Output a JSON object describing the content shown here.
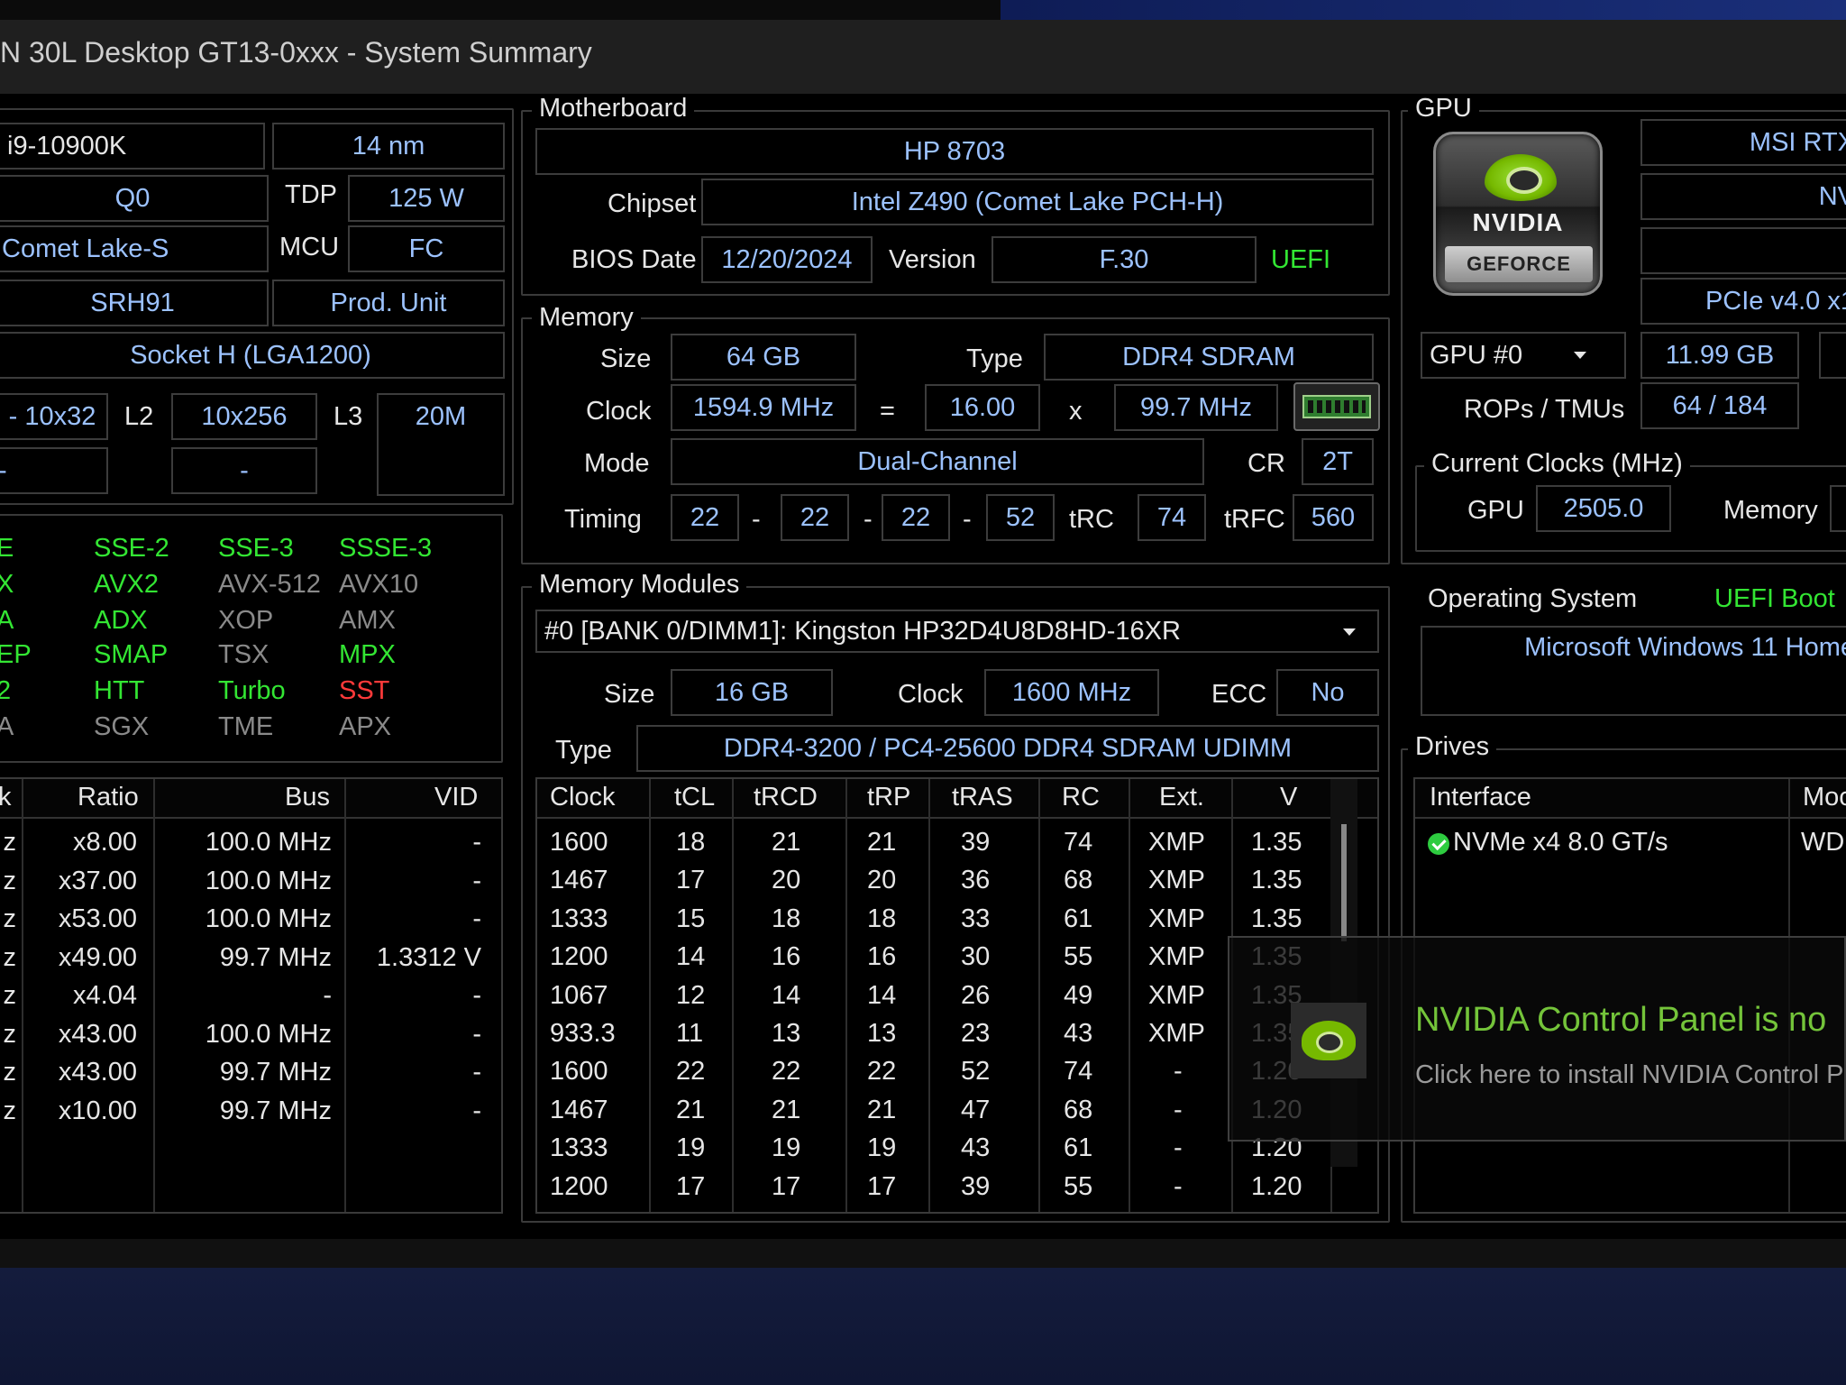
{
  "window": {
    "title": "N 30L Desktop GT13-0xxx - System Summary"
  },
  "cpu": {
    "name": "i9-10900K",
    "process": "14 nm",
    "stepping": "Q0",
    "tdp_label": "TDP",
    "tdp": "125 W",
    "codename": "Comet Lake-S",
    "mcu_label": "MCU",
    "mcu": "FC",
    "sspec": "SRH91",
    "prod_unit": "Prod. Unit",
    "socket": "Socket H (LGA1200)",
    "l1": "- 10x32",
    "l2_label": "L2",
    "l2": "10x256",
    "l3_label": "L3",
    "l3": "20M",
    "l1b": "-",
    "l2b": "-",
    "features": [
      {
        "text": "E",
        "color": "green"
      },
      {
        "text": "SSE-2",
        "color": "green"
      },
      {
        "text": "SSE-3",
        "color": "green"
      },
      {
        "text": "SSSE-3",
        "color": "green"
      },
      {
        "text": "X",
        "color": "green"
      },
      {
        "text": "AVX2",
        "color": "green"
      },
      {
        "text": "AVX-512",
        "color": "gray"
      },
      {
        "text": "AVX10",
        "color": "gray"
      },
      {
        "text": "A",
        "color": "green"
      },
      {
        "text": "ADX",
        "color": "green"
      },
      {
        "text": "XOP",
        "color": "gray"
      },
      {
        "text": "AMX",
        "color": "gray"
      },
      {
        "text": "EP",
        "color": "green"
      },
      {
        "text": "SMAP",
        "color": "green"
      },
      {
        "text": "TSX",
        "color": "gray"
      },
      {
        "text": "MPX",
        "color": "green"
      },
      {
        "text": "2",
        "color": "green"
      },
      {
        "text": "HTT",
        "color": "green"
      },
      {
        "text": "Turbo",
        "color": "green"
      },
      {
        "text": "SST",
        "color": "red"
      },
      {
        "text": "A",
        "color": "gray"
      },
      {
        "text": "SGX",
        "color": "gray"
      },
      {
        "text": "TME",
        "color": "gray"
      },
      {
        "text": "APX",
        "color": "gray"
      }
    ],
    "clock_table": {
      "headers": [
        "k",
        "Ratio",
        "Bus",
        "VID"
      ],
      "rows": [
        [
          "z",
          "x8.00",
          "100.0 MHz",
          "-"
        ],
        [
          "z",
          "x37.00",
          "100.0 MHz",
          "-"
        ],
        [
          "z",
          "x53.00",
          "100.0 MHz",
          "-"
        ],
        [
          "z",
          "x49.00",
          "99.7 MHz",
          "1.3312 V"
        ],
        [
          "z",
          "x4.04",
          "-",
          "-"
        ],
        [
          "z",
          "x43.00",
          "100.0 MHz",
          "-"
        ],
        [
          "z",
          "x43.00",
          "99.7 MHz",
          "-"
        ],
        [
          "z",
          "x10.00",
          "99.7 MHz",
          "-"
        ]
      ]
    }
  },
  "motherboard": {
    "label": "Motherboard",
    "model": "HP 8703",
    "chipset_label": "Chipset",
    "chipset": "Intel Z490 (Comet Lake PCH-H)",
    "bios_date_label": "BIOS Date",
    "bios_date": "12/20/2024",
    "version_label": "Version",
    "version": "F.30",
    "uefi": "UEFI"
  },
  "memory": {
    "label": "Memory",
    "size_label": "Size",
    "size": "64 GB",
    "type_label": "Type",
    "type": "DDR4 SDRAM",
    "clock_label": "Clock",
    "clock": "1594.9 MHz",
    "eq": "=",
    "multiplier": "16.00",
    "x": "x",
    "bus": "99.7 MHz",
    "mode_label": "Mode",
    "mode": "Dual-Channel",
    "cr_label": "CR",
    "cr": "2T",
    "timing_label": "Timing",
    "t1": "22",
    "t2": "22",
    "t3": "22",
    "t4": "52",
    "dash": "-",
    "trc_label": "tRC",
    "trc": "74",
    "trfc_label": "tRFC",
    "trfc": "560"
  },
  "modules": {
    "label": "Memory Modules",
    "selected": "#0 [BANK 0/DIMM1]: Kingston HP32D4U8D8HD-16XR",
    "size_label": "Size",
    "size": "16 GB",
    "clock_label": "Clock",
    "clock": "1600 MHz",
    "ecc_label": "ECC",
    "ecc": "No",
    "type_label": "Type",
    "type": "DDR4-3200 / PC4-25600 DDR4 SDRAM UDIMM",
    "table": {
      "headers": [
        "Clock",
        "tCL",
        "tRCD",
        "tRP",
        "tRAS",
        "RC",
        "Ext.",
        "V"
      ],
      "rows": [
        [
          "1600",
          "18",
          "21",
          "21",
          "39",
          "74",
          "XMP",
          "1.35"
        ],
        [
          "1467",
          "17",
          "20",
          "20",
          "36",
          "68",
          "XMP",
          "1.35"
        ],
        [
          "1333",
          "15",
          "18",
          "18",
          "33",
          "61",
          "XMP",
          "1.35"
        ],
        [
          "1200",
          "14",
          "16",
          "16",
          "30",
          "55",
          "XMP",
          "1.35"
        ],
        [
          "1067",
          "12",
          "14",
          "14",
          "26",
          "49",
          "XMP",
          "1.35"
        ],
        [
          "933.3",
          "11",
          "13",
          "13",
          "23",
          "43",
          "XMP",
          "1.35"
        ],
        [
          "1600",
          "22",
          "22",
          "22",
          "52",
          "74",
          "-",
          "1.20"
        ],
        [
          "1467",
          "21",
          "21",
          "21",
          "47",
          "68",
          "-",
          "1.20"
        ],
        [
          "1333",
          "19",
          "19",
          "19",
          "43",
          "61",
          "-",
          "1.20"
        ],
        [
          "1200",
          "17",
          "17",
          "17",
          "39",
          "55",
          "-",
          "1.20"
        ]
      ]
    }
  },
  "gpu": {
    "label": "GPU",
    "logo_brand": "NVIDIA",
    "logo_sub": "GEFORCE",
    "name": "MSI RTX",
    "subname": "NV",
    "blank": "",
    "pcie": "PCIe v4.0 x1",
    "selector": "GPU #0",
    "vram": "11.99 GB",
    "rops_label": "ROPs / TMUs",
    "rops": "64 / 184",
    "clocks_label": "Current Clocks (MHz)",
    "gpu_clk_label": "GPU",
    "gpu_clk": "2505.0",
    "mem_clk_label": "Memory"
  },
  "os": {
    "label": "Operating System",
    "boot": "UEFI Boot",
    "name": "Microsoft Windows 11 Home"
  },
  "drives": {
    "label": "Drives",
    "headers": [
      "Interface",
      "Moc"
    ],
    "rows": [
      [
        "NVMe x4 8.0 GT/s",
        "WD"
      ]
    ]
  },
  "toast": {
    "title": "NVIDIA Control Panel is no",
    "body": "Click here to install NVIDIA Control P"
  }
}
